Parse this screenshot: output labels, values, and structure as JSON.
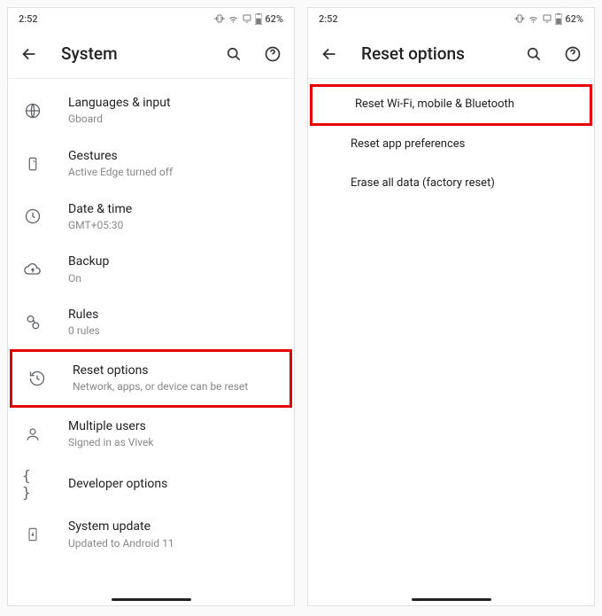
{
  "status": {
    "time": "2:52",
    "battery": "62%"
  },
  "left": {
    "title": "System",
    "items": [
      {
        "title": "Languages & input",
        "sub": "Gboard"
      },
      {
        "title": "Gestures",
        "sub": "Active Edge turned off"
      },
      {
        "title": "Date & time",
        "sub": "GMT+05:30"
      },
      {
        "title": "Backup",
        "sub": "On"
      },
      {
        "title": "Rules",
        "sub": "0 rules"
      },
      {
        "title": "Reset options",
        "sub": "Network, apps, or device can be reset"
      },
      {
        "title": "Multiple users",
        "sub": "Signed in as Vivek"
      },
      {
        "title": "Developer options",
        "sub": ""
      },
      {
        "title": "System update",
        "sub": "Updated to Android 11"
      }
    ]
  },
  "right": {
    "title": "Reset options",
    "items": [
      {
        "title": "Reset Wi-Fi, mobile & Bluetooth"
      },
      {
        "title": "Reset app preferences"
      },
      {
        "title": "Erase all data (factory reset)"
      }
    ]
  }
}
